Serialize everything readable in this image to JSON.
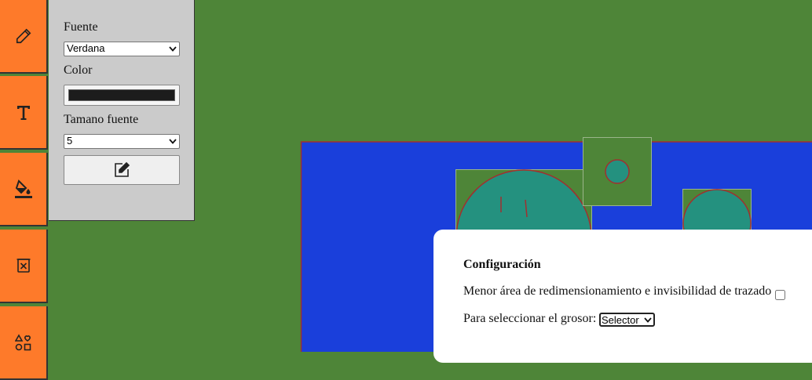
{
  "toolbar": {
    "tools": [
      {
        "icon": "pencil-icon"
      },
      {
        "icon": "text-icon"
      },
      {
        "icon": "paint-bucket-icon"
      },
      {
        "icon": "delete-icon"
      },
      {
        "icon": "shapes-icon"
      }
    ]
  },
  "text_panel": {
    "font_label": "Fuente",
    "font_value": "Verdana",
    "color_label": "Color",
    "color_value": "#1c1c1c",
    "size_label": "Tamano fuente",
    "size_value": "5",
    "edit_icon": "edit-icon"
  },
  "colors": {
    "background": "#4e8538",
    "toolbar": "#fe7a2a",
    "panel": "#cbcbcb",
    "canvas_blue": "#1a3fdb",
    "shape_teal": "#24917f",
    "outline": "#a03030"
  },
  "dialog": {
    "title": "Configuración",
    "option_label": "Menor área de redimensionamiento e invisibilidad de trazado",
    "option_checked": false,
    "thickness_label": "Para seleccionar el grosor:",
    "thickness_value": "Selector"
  }
}
